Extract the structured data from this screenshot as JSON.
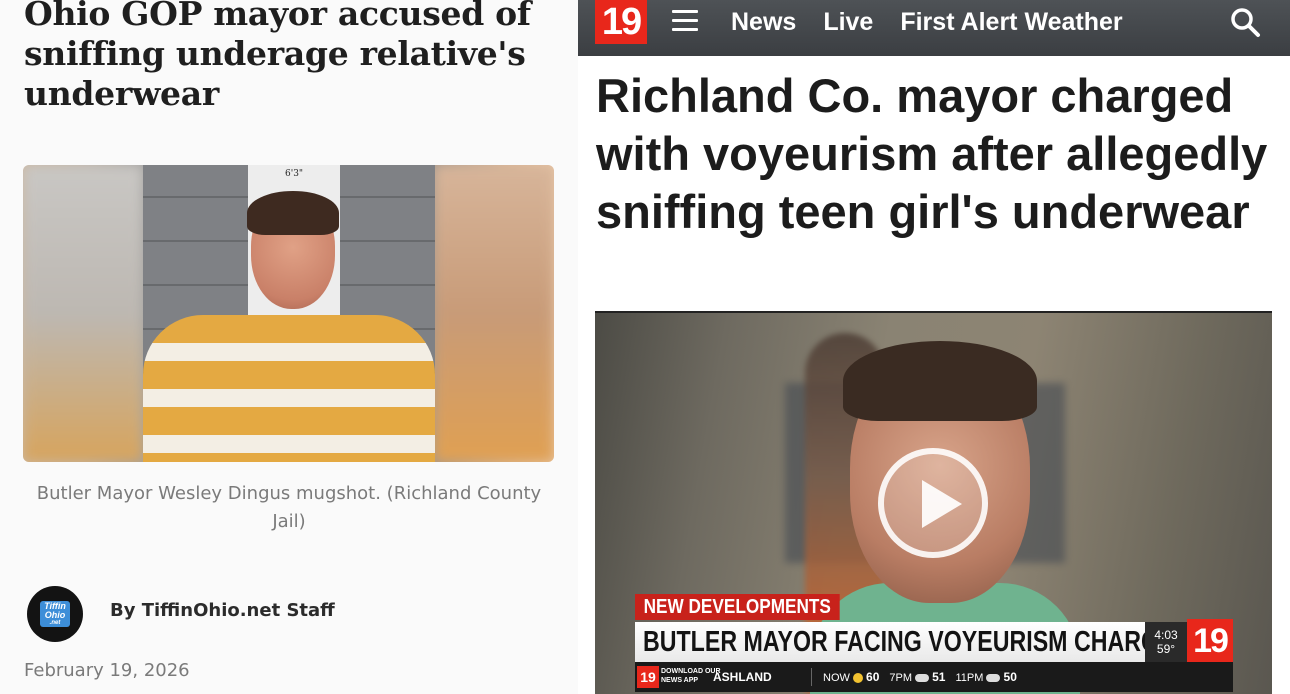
{
  "left": {
    "headline": "Ohio GOP mayor accused of sniffing underage relative's underwear",
    "photo_height_mark": "6'3\"",
    "caption": "Butler Mayor Wesley Dingus mugshot. (Richland County Jail)",
    "logo": {
      "line1": "Tiffin",
      "line2": "Ohio",
      "line3": ".net"
    },
    "byline_prefix": "By",
    "byline_author": "TiffinOhio.net Staff",
    "date": "February 19, 2026"
  },
  "right": {
    "nav": {
      "logo": "19",
      "links": [
        "News",
        "Live",
        "First Alert Weather"
      ],
      "icons": {
        "menu": "hamburger-menu-icon",
        "search": "search-icon"
      },
      "colors": {
        "bar": "#3b3e42",
        "logo_red": "#e8271b"
      }
    },
    "headline": "Richland Co. mayor charged with voyeurism after allegedly sniffing teen girl's underwear",
    "video": {
      "tag": "NEW DEVELOPMENTS",
      "lower_third": "BUTLER MAYOR FACING VOYEURISM CHARGES",
      "time": "4:03",
      "temp": "59°",
      "logo": "19",
      "ticker": {
        "app_line1": "DOWNLOAD OUR",
        "app_line2": "NEWS APP",
        "city": "ASHLAND",
        "forecast": [
          {
            "label": "NOW",
            "temp": "60",
            "icon": "sun-icon"
          },
          {
            "label": "7PM",
            "temp": "51",
            "icon": "cloud-icon"
          },
          {
            "label": "11PM",
            "temp": "50",
            "icon": "cloud-icon"
          }
        ]
      }
    }
  }
}
